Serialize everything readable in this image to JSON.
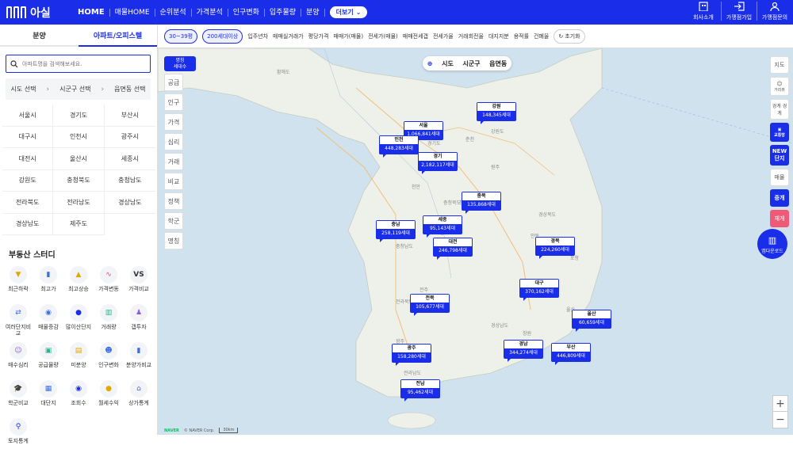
{
  "app": {
    "logo_text": "아실",
    "more_label": "더보기"
  },
  "nav": {
    "items": [
      "HOME",
      "매물HOME",
      "순위분석",
      "가격분석",
      "인구변화",
      "입주물량",
      "분양"
    ],
    "active_index": 0
  },
  "top_right": {
    "items": [
      "회사소개",
      "가맹점가입",
      "가맹점문의"
    ]
  },
  "left": {
    "tabs": [
      "분양",
      "아파트/오피스텔"
    ],
    "active_tab": 1,
    "search_placeholder": "아파트명을 검색해보세요.",
    "selectors": [
      "시도 선택",
      "시군구 선택",
      "읍면동 선택"
    ],
    "regions": [
      "서울시",
      "경기도",
      "부산시",
      "대구시",
      "인천시",
      "광주시",
      "대전시",
      "울산시",
      "세종시",
      "강원도",
      "충청북도",
      "충청남도",
      "전라북도",
      "전라남도",
      "경상남도",
      "경상남도",
      "제주도"
    ],
    "study_title": "부동산 스터디",
    "study_items": [
      "최근하락",
      "최고가",
      "최고상승",
      "가격변동",
      "가격비교",
      "여러단지비교",
      "매물증감",
      "많이산단지",
      "거래량",
      "갭투자",
      "매수심리",
      "공급물량",
      "미분양",
      "인구변화",
      "분양가비교",
      "학군비교",
      "대단지",
      "조회수",
      "월세수익",
      "상가통계",
      "토지통계"
    ]
  },
  "filters": [
    "30~39평",
    "200세대이상",
    "입주년차",
    "매매실거래가",
    "평당가격",
    "매매가(매물)",
    "전세가(매물)",
    "매매전세갭",
    "전세가율",
    "거래회전율",
    "대지지분",
    "용적률",
    "건폐율",
    "초기화"
  ],
  "side_tools": {
    "head_line1": "명칭",
    "head_line2": "세대수",
    "buttons": [
      "공급",
      "인구",
      "가격",
      "심리",
      "거래",
      "비교",
      "정책",
      "학군",
      "명칭"
    ]
  },
  "geo_switch": [
    "시도",
    "시군구",
    "읍면동"
  ],
  "right_tools": [
    "지도",
    "거리뷰",
    "경계 경계",
    "교통망",
    "NEW 단지",
    "매물",
    "증개",
    "재개"
  ],
  "app_download": "앱다운로드",
  "markers": [
    {
      "name": "서울",
      "value": "1,066,841세대"
    },
    {
      "name": "인천",
      "value": "448,283세대"
    },
    {
      "name": "강원",
      "value": "148,345세대"
    },
    {
      "name": "경기",
      "value": "2,182,117세대"
    },
    {
      "name": "충북",
      "value": "135,868세대"
    },
    {
      "name": "세종",
      "value": "95,143세대"
    },
    {
      "name": "충남",
      "value": "258,119세대"
    },
    {
      "name": "대전",
      "value": "246,798세대"
    },
    {
      "name": "경북",
      "value": "224,260세대"
    },
    {
      "name": "대구",
      "value": "370,162세대"
    },
    {
      "name": "전북",
      "value": "105,677세대"
    },
    {
      "name": "울산",
      "value": "60,659세대"
    },
    {
      "name": "광주",
      "value": "158,280세대"
    },
    {
      "name": "경남",
      "value": "344,274세대"
    },
    {
      "name": "부산",
      "value": "446,809세대"
    },
    {
      "name": "전남",
      "value": "95,462세대"
    }
  ],
  "map_labels": [
    "황해도",
    "강원도",
    "경기도",
    "충청북도",
    "충청남도",
    "경상북도",
    "전라북도",
    "경상남도",
    "전라남도",
    "춘천",
    "원주",
    "청주",
    "천안",
    "대전",
    "대구",
    "울산",
    "전주",
    "광주",
    "창원",
    "부산",
    "포항",
    "안동"
  ],
  "attrib": {
    "brand": "NAVER",
    "copyright": "© NAVER Corp.",
    "scale": "30km"
  }
}
